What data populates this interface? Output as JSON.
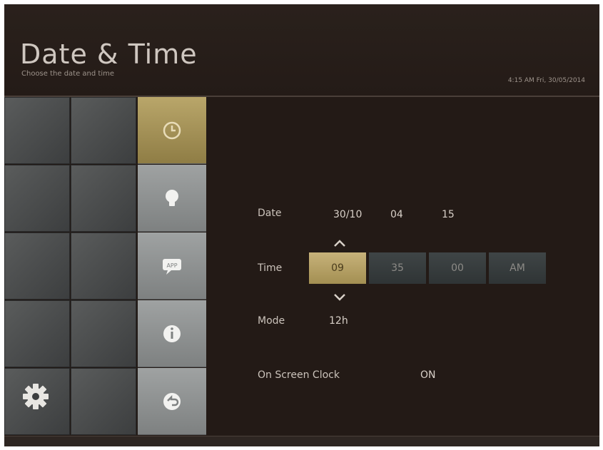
{
  "header": {
    "title": "Date & Time",
    "subtitle": "Choose the date and time",
    "status": "4:15 AM Fri, 30/05/2014"
  },
  "menu": {
    "items": [
      {
        "icon": "clock-icon",
        "active": true
      },
      {
        "icon": "lightbulb-icon",
        "active": false
      },
      {
        "icon": "app-icon",
        "active": false
      },
      {
        "icon": "info-icon",
        "active": false
      },
      {
        "icon": "back-icon",
        "active": false
      }
    ]
  },
  "content": {
    "date_label": "Date",
    "date_day_month": "30/10",
    "date_part2": "04",
    "date_part3": "15",
    "time_label": "Time",
    "time_hour": "09",
    "time_minute": "35",
    "time_second": "00",
    "time_ampm": "AM",
    "mode_label": "Mode",
    "mode_value": "12h",
    "clock_label": "On Screen Clock",
    "clock_value": "ON"
  },
  "icons": {
    "settings": "gear-icon",
    "up": "chevron-up-icon",
    "down": "chevron-down-icon"
  },
  "colors": {
    "accent_gold": "#b9a66a",
    "background": "#221a16",
    "menu_grey": "#9fa2a2"
  }
}
